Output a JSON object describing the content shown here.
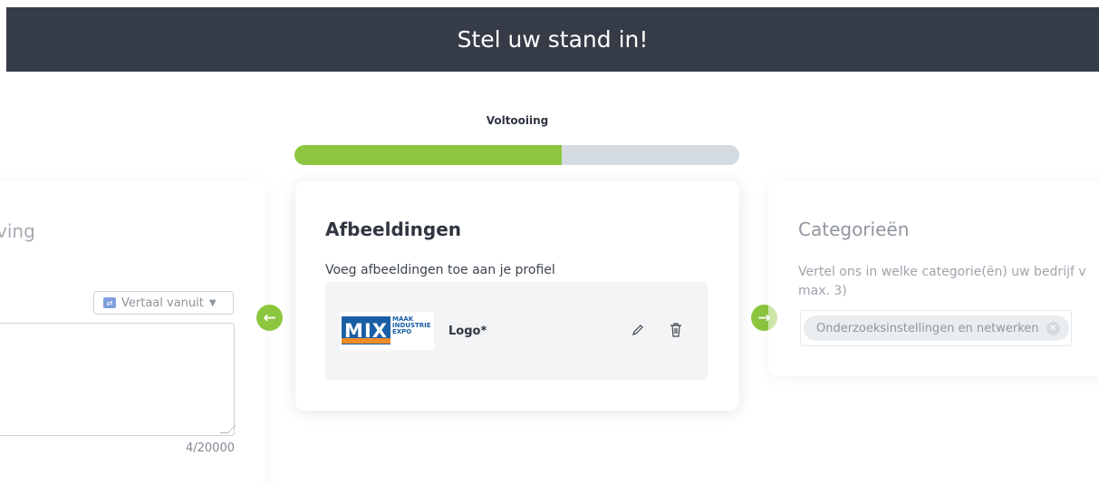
{
  "header": {
    "title": "Stel uw stand in!"
  },
  "progress": {
    "label": "Voltooiing",
    "fraction": 0.6
  },
  "left_panel": {
    "title_fragment": "ving",
    "translate_label": "Vertaal vanuit",
    "char_count": "4/20000"
  },
  "main_panel": {
    "title": "Afbeeldingen",
    "subtitle": "Voeg afbeeldingen toe aan je profiel",
    "image": {
      "label": "Logo*",
      "logo_text": "MIX",
      "logo_words": [
        "MAAK",
        "INDUSTRIE",
        "EXPO"
      ]
    }
  },
  "right_panel": {
    "title": "Categorieën",
    "description": "Vertel ons in welke categorie(ën) uw bedrijf v max. 3)",
    "chip_label": "Onderzoeksinstellingen en netwerken"
  },
  "icons": {
    "prev": "arrow-left-icon",
    "next": "arrow-right-icon",
    "edit": "pencil-icon",
    "delete": "trash-icon",
    "remove": "close-circle-icon",
    "translate": "translate-icon",
    "dropdown": "caret-down-icon"
  },
  "colors": {
    "header_bg": "#353b47",
    "accent": "#8cc63f",
    "track": "#d3dbe0"
  }
}
